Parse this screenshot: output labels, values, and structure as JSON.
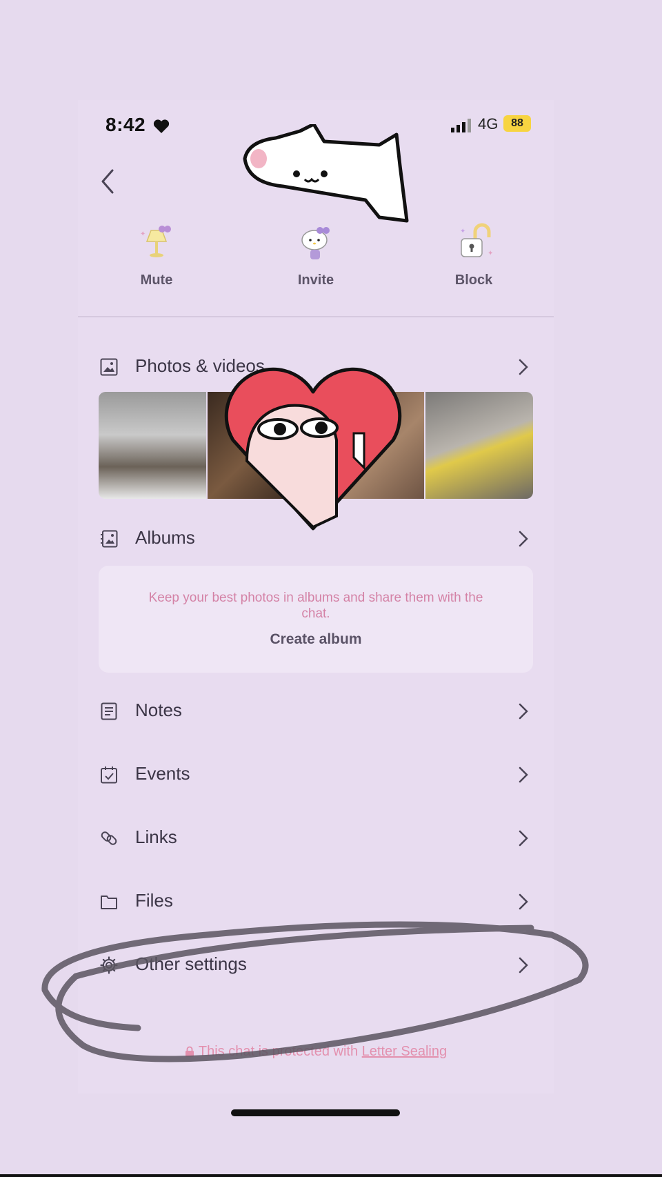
{
  "status_bar": {
    "time": "8:42",
    "network": "4G",
    "battery": "88"
  },
  "actions": [
    {
      "label": "Mute"
    },
    {
      "label": "Invite"
    },
    {
      "label": "Block"
    }
  ],
  "sections": {
    "photos": {
      "label": "Photos & videos"
    },
    "albums": {
      "label": "Albums",
      "empty_hint": "Keep your best photos in albums and share them with the chat.",
      "create_label": "Create album"
    },
    "notes": {
      "label": "Notes"
    },
    "events": {
      "label": "Events"
    },
    "links": {
      "label": "Links"
    },
    "files": {
      "label": "Files"
    },
    "other_settings": {
      "label": "Other settings"
    }
  },
  "footer": {
    "text": "This chat is protected with ",
    "link": "Letter Sealing"
  },
  "colors": {
    "background": "#e8dcf0",
    "accent_pink": "#e390ae",
    "battery": "#f7d441"
  },
  "icons": [
    "heart-icon",
    "signal-icon",
    "back-icon",
    "mute-icon",
    "invite-icon",
    "block-icon",
    "image-icon",
    "album-icon",
    "notes-icon",
    "events-icon",
    "links-icon",
    "folder-icon",
    "gear-icon",
    "chevron-right-icon",
    "lock-icon"
  ]
}
